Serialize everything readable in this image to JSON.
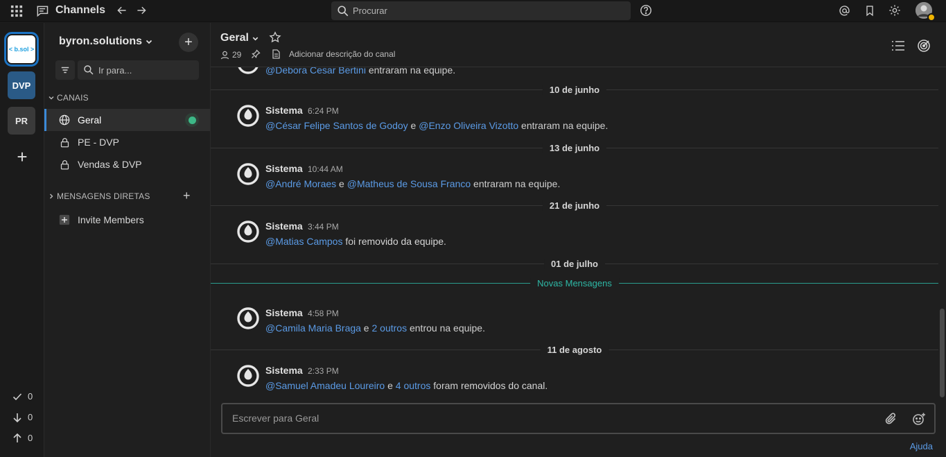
{
  "topbar": {
    "title": "Channels",
    "search_placeholder": "Procurar"
  },
  "teams": [
    {
      "label": "< b.sol >"
    },
    {
      "label": "DVP"
    },
    {
      "label": "PR"
    }
  ],
  "counters": {
    "done": "0",
    "down": "0",
    "up": "0"
  },
  "sidebar": {
    "team_name": "byron.solutions",
    "find_placeholder": "Ir para...",
    "channels_header": "CANAIS",
    "channels": [
      {
        "label": "Geral",
        "icon": "globe-icon",
        "active": true
      },
      {
        "label": "PE - DVP",
        "icon": "lock-icon"
      },
      {
        "label": "Vendas & DVP",
        "icon": "lock-icon"
      }
    ],
    "dm_header": "MENSAGENS DIRETAS",
    "invite_label": "Invite Members"
  },
  "channel": {
    "name": "Geral",
    "members_count": "29",
    "add_description": "Adicionar descrição do canal"
  },
  "feed": {
    "partial_text": {
      "mention": "@Debora Cesar Bertini",
      "rest": " entraram na equipe."
    },
    "new_messages_label": "Novas Mensagens",
    "date_separators": [
      "10 de junho",
      "13 de junho",
      "21 de junho",
      "01 de julho",
      "11 de agosto"
    ],
    "posts": [
      {
        "name": "Sistema",
        "time": "6:24 PM",
        "m1": "@César Felipe Santos de Godoy",
        "sep": " e ",
        "m2": "@Enzo Oliveira Vizotto",
        "rest": " entraram na equipe."
      },
      {
        "name": "Sistema",
        "time": "10:44 AM",
        "m1": "@André Moraes",
        "sep": " e ",
        "m2": "@Matheus de Sousa Franco",
        "rest": " entraram na equipe."
      },
      {
        "name": "Sistema",
        "time": "3:44 PM",
        "m1": "@Matias Campos",
        "sep": " foi ",
        "bold": "removido da equipe",
        "end": "."
      },
      {
        "name": "Sistema",
        "time": "4:58 PM",
        "m1": "@Camila Maria Braga",
        "sep": " e ",
        "m2": "2 outros",
        "rest": " entrou na equipe."
      },
      {
        "name": "Sistema",
        "time": "2:33 PM",
        "m1": "@Samuel Amadeu Loureiro",
        "sep": " e ",
        "m2": "4 outros",
        "sep2": " foram ",
        "bold": "removidos do canal",
        "end": "."
      }
    ]
  },
  "composer": {
    "placeholder": "Escrever para Geral"
  },
  "help_label": "Ajuda",
  "colors": {
    "accent": "#3b8ad8",
    "mention": "#5b9be6",
    "new_messages": "#2eb8a6",
    "online": "#3db887",
    "away": "#f0b400"
  }
}
